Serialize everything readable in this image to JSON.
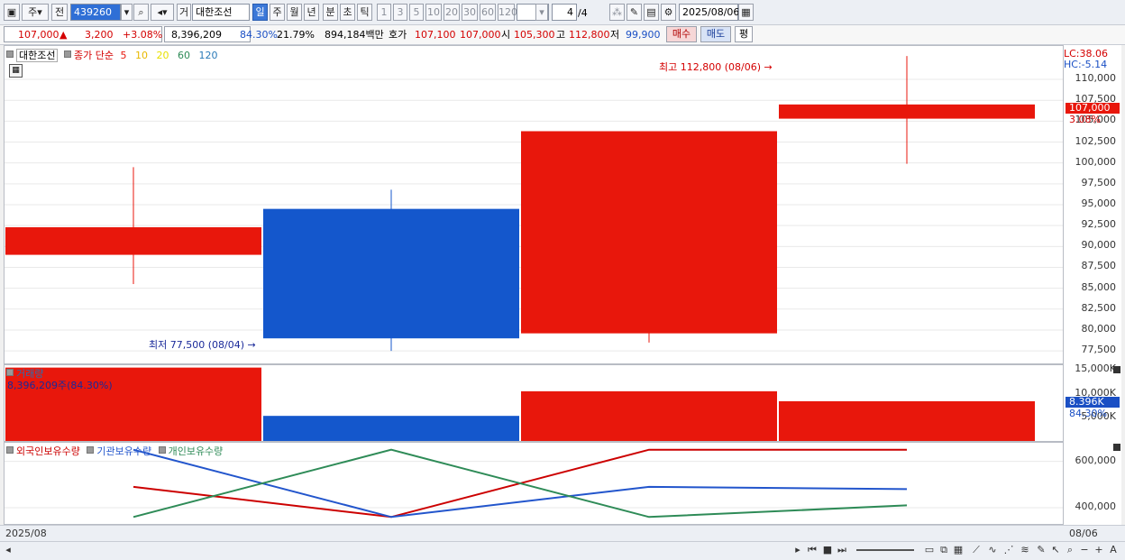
{
  "toolbar": {
    "period_type": "주",
    "prev_label": "전",
    "code": "439260",
    "name": "대한조선",
    "name_prefix": "거",
    "tabs": [
      "일",
      "주",
      "월",
      "년",
      "분",
      "초",
      "틱"
    ],
    "intervals": [
      "1",
      "3",
      "5",
      "10",
      "20",
      "30",
      "60",
      "120"
    ],
    "page": "4",
    "page_total": "/4",
    "date": "2025/08/06"
  },
  "quote": {
    "price": "107,000",
    "arrow": "▲",
    "change": "3,200",
    "change_pct": "+3.08%",
    "volume": "8,396,209",
    "vol_ratio": "84.30%",
    "turnover": "21.79%",
    "amount": "894,184백만",
    "bid_label": "호가",
    "bid": "107,100",
    "ask": "107,000",
    "open_label": "시",
    "open": "105,300",
    "high_label": "고",
    "high": "112,800",
    "low_label": "저",
    "low": "99,900",
    "buy_label": "매수",
    "sell_label": "매도",
    "avg_label": "평"
  },
  "price_panel": {
    "stock_label": "대한조선",
    "ma_label": "종가 단순",
    "ma_periods": [
      "5",
      "10",
      "20",
      "60",
      "120"
    ],
    "ma_colors": [
      "#e8170c",
      "#e8b800",
      "#e8e000",
      "#2e8b57",
      "#2a7ab8"
    ],
    "lc": "LC:38.06",
    "hc": "HC:-5.14",
    "max_note": "최고 112,800 (08/06)",
    "min_note": "최저 77,500 (08/04)",
    "last_price": "107,000",
    "last_pct": "3.08%",
    "y_ticks": [
      "110,000",
      "107,500",
      "105,000",
      "102,500",
      "100,000",
      "97,500",
      "95,000",
      "92,500",
      "90,000",
      "87,500",
      "85,000",
      "82,500",
      "80,000",
      "77,500"
    ]
  },
  "volume_panel": {
    "title": "거래량",
    "value_note": "8,396,209주(84.30%)",
    "last_vol": "8.396K",
    "last_pct": "84.30%",
    "y_ticks": [
      "15,000K",
      "10,000K",
      "5,000K"
    ]
  },
  "holding_panel": {
    "legend": [
      "외국인보유수량",
      "기관보유수량",
      "개인보유수량"
    ],
    "legend_colors": [
      "#cc0000",
      "#2255cc",
      "#2e8b57"
    ],
    "y_ticks": [
      "600,000",
      "400,000"
    ]
  },
  "bottom": {
    "left_date": "2025/08",
    "right_date": "08/06"
  },
  "chart_data": [
    {
      "type": "candlestick",
      "ylim": [
        76000,
        114000
      ],
      "candles": [
        {
          "open": 89000,
          "high": 99500,
          "low": 85500,
          "close": 92300,
          "color": "#e8170c"
        },
        {
          "open": 94500,
          "high": 96800,
          "low": 77500,
          "close": 79000,
          "color": "#1457cc"
        },
        {
          "open": 79600,
          "high": 103800,
          "low": 78500,
          "close": 103800,
          "color": "#e8170c"
        },
        {
          "open": 105300,
          "high": 112800,
          "low": 99900,
          "close": 107000,
          "color": "#e8170c"
        }
      ]
    },
    {
      "type": "bar",
      "title": "거래량",
      "ylim": [
        0,
        16000000
      ],
      "values": [
        15500000,
        5300000,
        10500000,
        8396209
      ],
      "colors": [
        "#e8170c",
        "#1457cc",
        "#e8170c",
        "#e8170c"
      ]
    },
    {
      "type": "line",
      "ylim": [
        330000,
        680000
      ],
      "series": [
        {
          "name": "외국인보유수량",
          "color": "#cc0000",
          "values": [
            490000,
            360000,
            650000,
            650000
          ]
        },
        {
          "name": "기관보유수량",
          "color": "#2255cc",
          "values": [
            650000,
            360000,
            490000,
            480000
          ]
        },
        {
          "name": "개인보유수량",
          "color": "#2e8b57",
          "values": [
            360000,
            650000,
            360000,
            410000
          ]
        }
      ]
    }
  ]
}
